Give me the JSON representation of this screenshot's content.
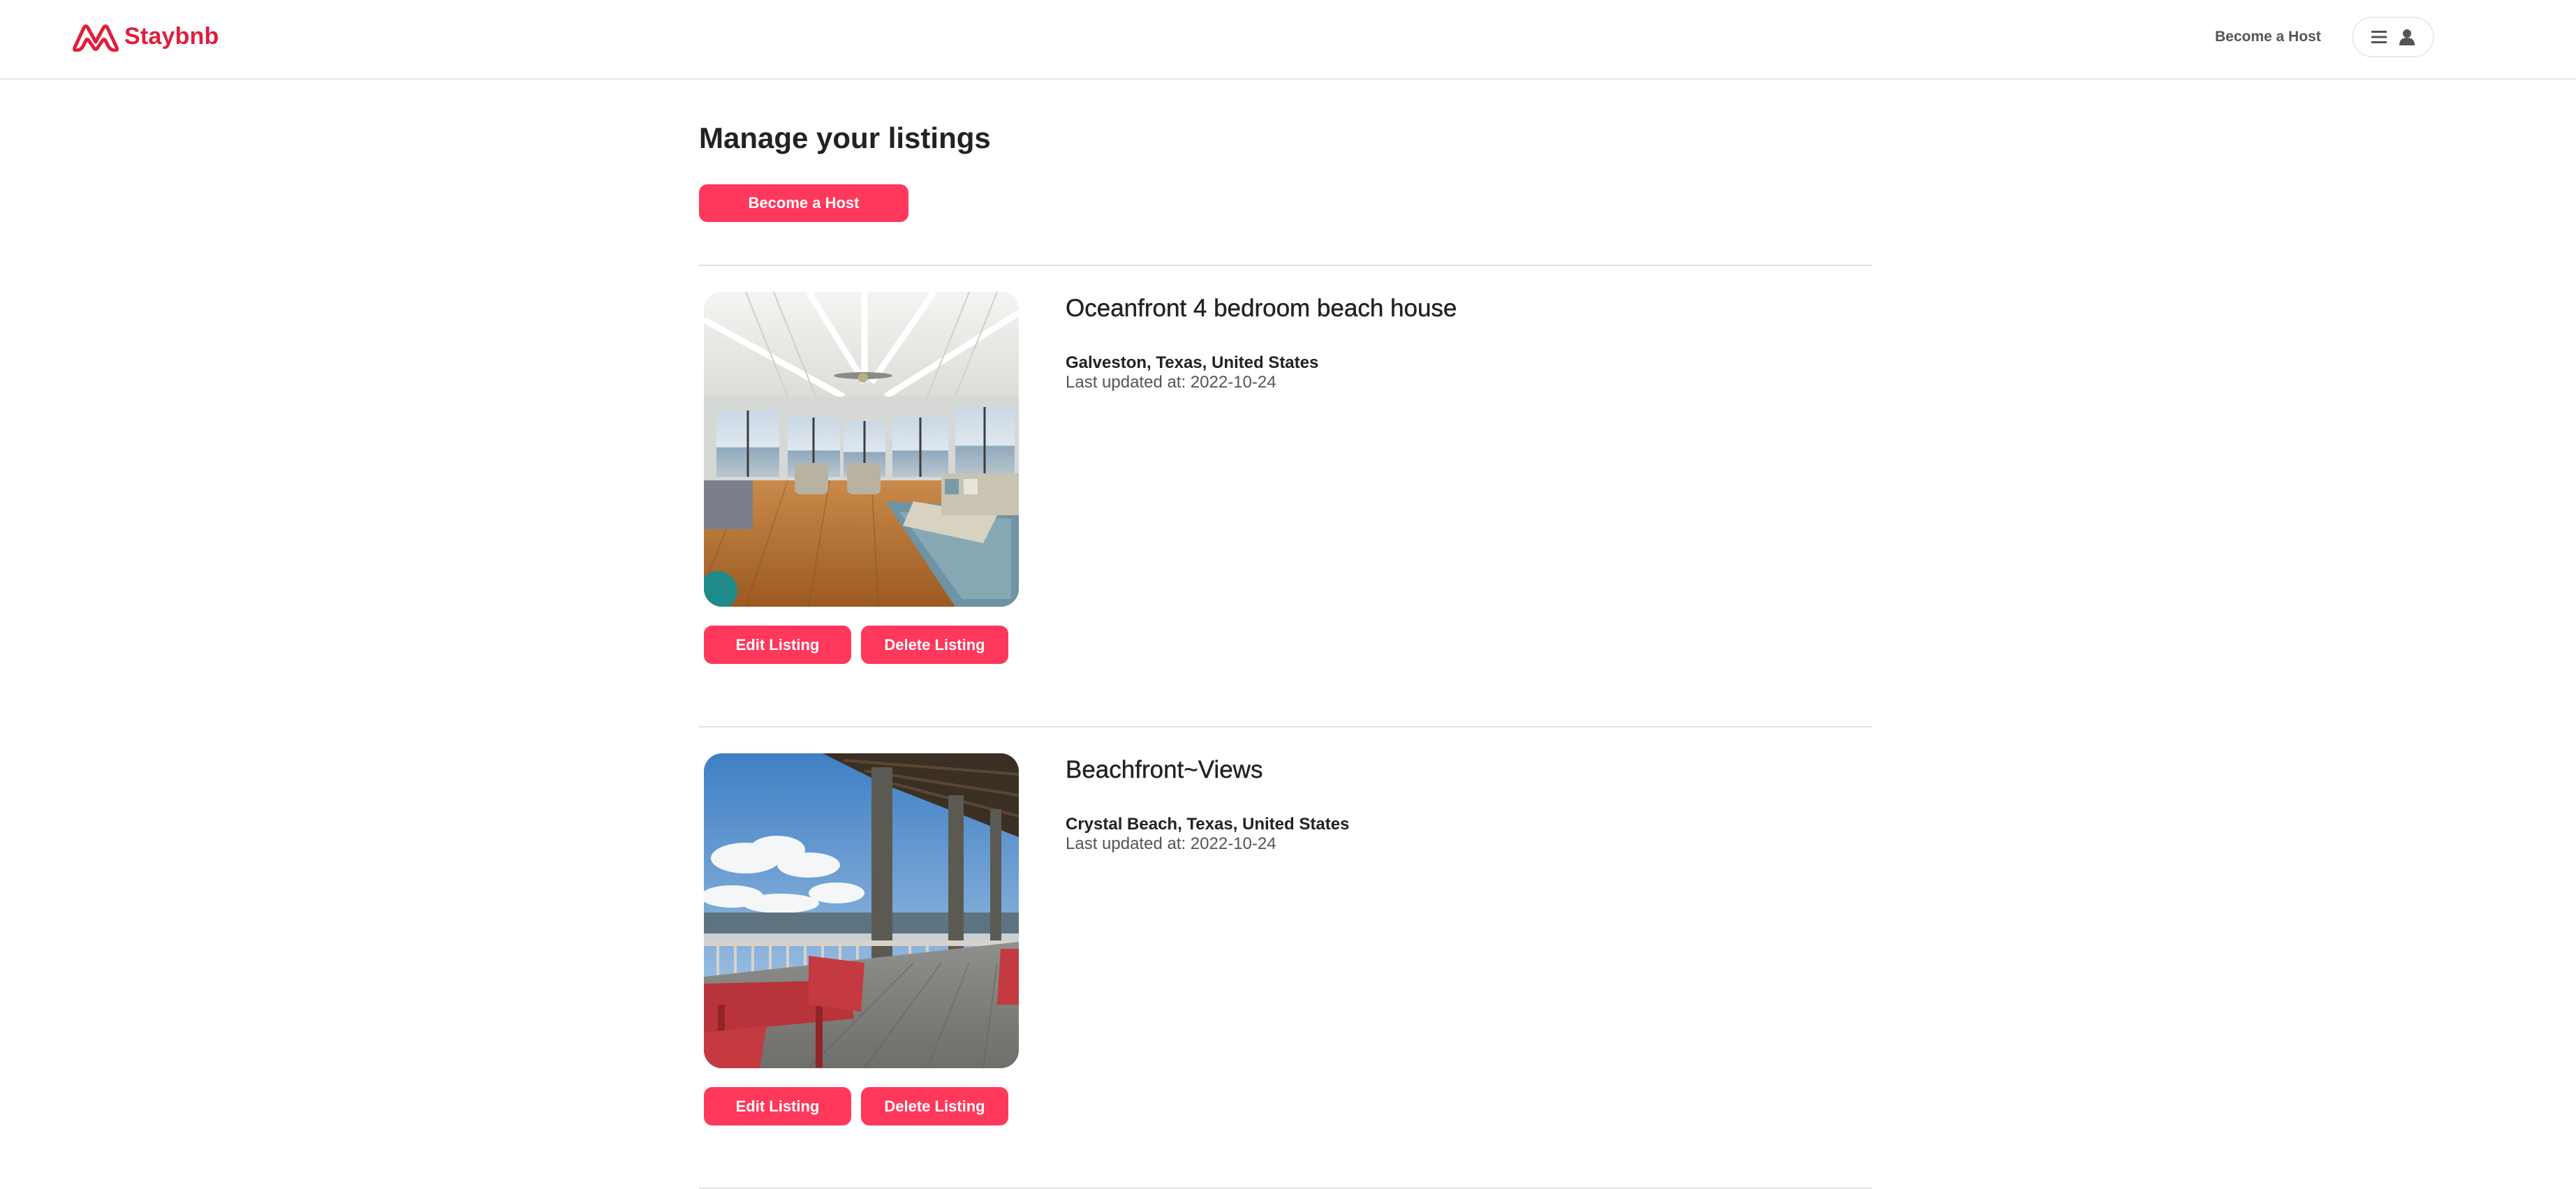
{
  "header": {
    "brand": "Staybnb",
    "become_host_link": "Become a Host",
    "menu_icon": "hamburger-menu-icon",
    "user_icon": "user-avatar-icon"
  },
  "main": {
    "title": "Manage your listings",
    "become_host_button": "Become a Host",
    "edit_label": "Edit Listing",
    "delete_label": "Delete Listing",
    "listings": [
      {
        "title": "Oceanfront 4 bedroom beach house",
        "location": "Galveston, Texas, United States",
        "last_updated": "Last updated at: 2022-10-24",
        "photo": "beach-house-living-room-photo"
      },
      {
        "title": "Beachfront~Views",
        "location": "Crystal Beach, Texas, United States",
        "last_updated": "Last updated at: 2022-10-24",
        "photo": "beachfront-porch-photo"
      }
    ]
  },
  "colors": {
    "brand": "#e01e3c",
    "button": "#ff385c",
    "button_text": "#ffffff",
    "divider": "#e3e3e3"
  }
}
